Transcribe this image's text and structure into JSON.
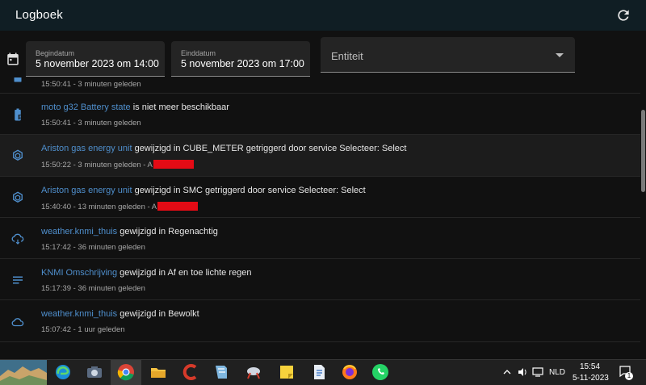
{
  "app": {
    "title": "Logboek"
  },
  "filters": {
    "start_label": "Begindatum",
    "start_value": "5 november 2023 om 14:00",
    "end_label": "Einddatum",
    "end_value": "5 november 2023 om 17:00",
    "entity_placeholder": "Entiteit"
  },
  "entries": [
    {
      "entity": "",
      "message": "",
      "meta": "15:50:41 - 3 minuten geleden"
    },
    {
      "entity": "moto g32 Battery state",
      "message": " is niet meer beschikbaar",
      "meta": "15:50:41 - 3 minuten geleden"
    },
    {
      "entity": "Ariston gas energy unit",
      "message": " gewijzigd in CUBE_METER getriggerd door service Selecteer: Select",
      "meta": "15:50:22 - 3 minuten geleden - A"
    },
    {
      "entity": "Ariston gas energy unit",
      "message": " gewijzigd in SMC getriggerd door service Selecteer: Select",
      "meta": "15:40:40 - 13 minuten geleden - A"
    },
    {
      "entity": "weather.knmi_thuis",
      "message": " gewijzigd in Regenachtig",
      "meta": "15:17:42 - 36 minuten geleden"
    },
    {
      "entity": "KNMI Omschrijving",
      "message": " gewijzigd in Af en toe lichte regen",
      "meta": "15:17:39 - 36 minuten geleden"
    },
    {
      "entity": "weather.knmi_thuis",
      "message": " gewijzigd in Bewolkt",
      "meta": "15:07:42 - 1 uur geleden"
    }
  ],
  "taskbar": {
    "language": "NLD",
    "time": "15:54",
    "date": "5-11-2023",
    "notification_count": "1"
  },
  "colors": {
    "entity_link": "#4f8fcd",
    "redaction": "#e40b15",
    "header_bg": "#101e24"
  }
}
